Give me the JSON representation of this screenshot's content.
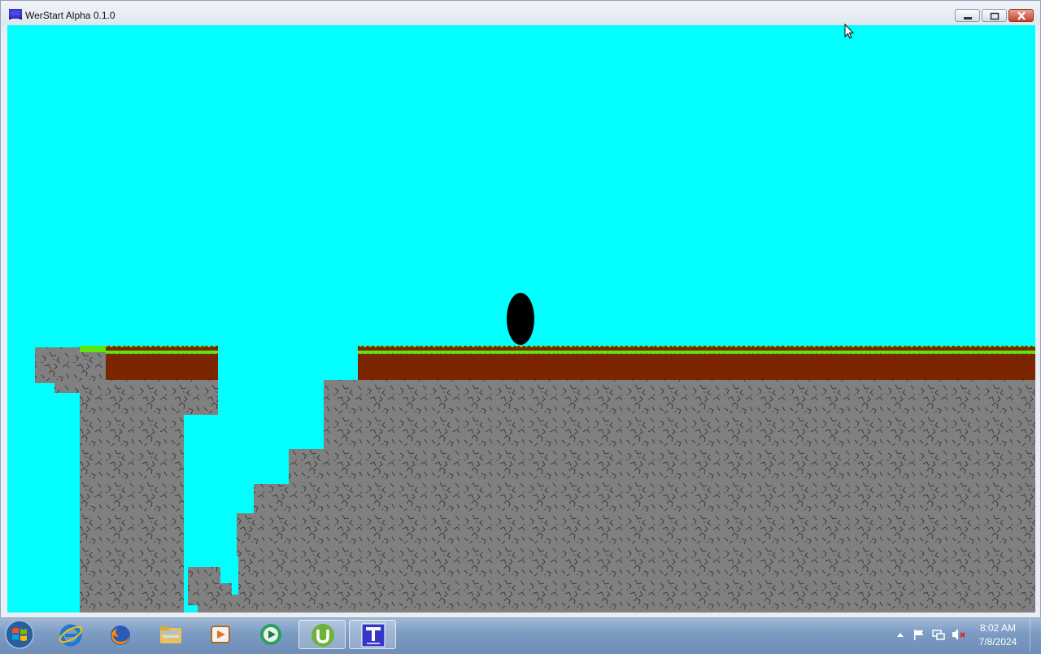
{
  "window": {
    "title": "WerStart Alpha 0.1.0",
    "controls": [
      "minimize",
      "maximize",
      "close"
    ]
  },
  "game": {
    "sky_color": "#00ffff",
    "grass_color": "#5ee60f",
    "dirt_color": "#7b2600",
    "stone_color": "#808080",
    "player_color": "#000000",
    "player_shape": "black-oval",
    "terrain": [
      "grass-dirt-platform-left",
      "grass-dirt-platform-right",
      "stone-cliff-left",
      "stone-staircase",
      "stone-ground"
    ]
  },
  "taskbar": {
    "start_icon": "windows-start-icon",
    "pinned": [
      {
        "name": "internet-explorer-icon",
        "active": false
      },
      {
        "name": "firefox-icon",
        "active": false
      },
      {
        "name": "file-explorer-icon",
        "active": false
      },
      {
        "name": "media-player-icon",
        "active": false
      },
      {
        "name": "media-center-icon",
        "active": false
      },
      {
        "name": "utorrent-icon",
        "active": true
      },
      {
        "name": "game-app-icon",
        "active": true
      }
    ],
    "tray": {
      "icons": [
        "show-hidden-icons-chevron",
        "action-center-flag-icon",
        "network-icon",
        "volume-muted-icon"
      ],
      "time": "8:02 AM",
      "date": "7/8/2024"
    }
  }
}
